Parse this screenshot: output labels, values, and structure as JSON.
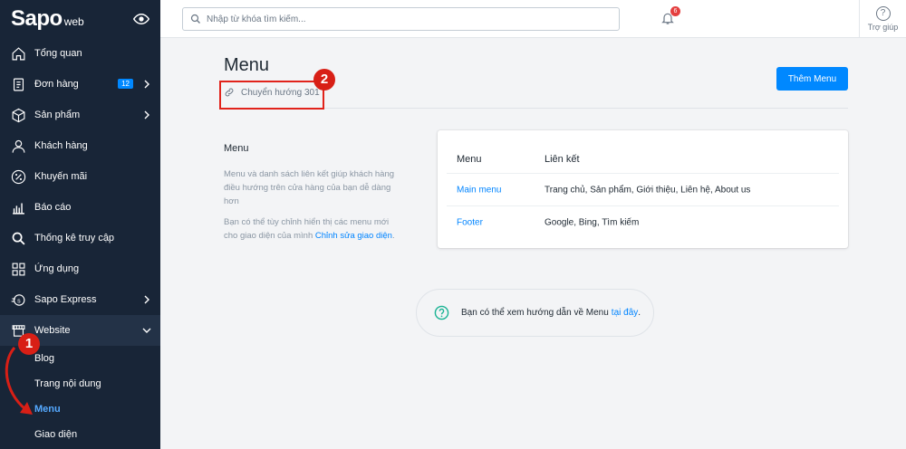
{
  "sidebar": {
    "logo_main": "Sapo",
    "logo_sub": "web",
    "items": [
      {
        "label": "Tổng quan"
      },
      {
        "label": "Đơn hàng",
        "badge": "12"
      },
      {
        "label": "Sản phẩm"
      },
      {
        "label": "Khách hàng"
      },
      {
        "label": "Khuyến mãi"
      },
      {
        "label": "Báo cáo"
      },
      {
        "label": "Thống kê truy cập"
      },
      {
        "label": "Ứng dụng"
      },
      {
        "label": "Sapo Express"
      },
      {
        "label": "Website"
      }
    ],
    "sub_items": [
      {
        "label": "Blog"
      },
      {
        "label": "Trang nội dung"
      },
      {
        "label": "Menu"
      },
      {
        "label": "Giao diện"
      }
    ]
  },
  "topbar": {
    "search_placeholder": "Nhập từ khóa tìm kiếm...",
    "notification_count": "6",
    "help_label": "Trợ giúp"
  },
  "main": {
    "title": "Menu",
    "redirect_label": "Chuyển hướng 301",
    "add_button": "Thêm Menu",
    "section_title": "Menu",
    "desc_1": "Menu và danh sách liên kết giúp khách hàng điều hướng trên cửa hàng của bạn dễ dàng hơn",
    "desc_2_prefix": "Bạn có thể tùy chỉnh hiển thị các menu mới cho giao diện của mình ",
    "desc_2_link": "Chỉnh sửa giao diện",
    "desc_2_suffix": ".",
    "table": {
      "headers": [
        "Menu",
        "Liên kết"
      ],
      "rows": [
        {
          "menu": "Main menu",
          "links": "Trang chủ, Sản phẩm, Giới thiệu, Liên hệ, About us"
        },
        {
          "menu": "Footer",
          "links": "Google, Bing, Tìm kiếm"
        }
      ]
    },
    "hint_prefix": "Bạn có thể xem hướng dẫn về Menu",
    "hint_link": "tại đây",
    "hint_suffix": "."
  },
  "annotations": {
    "marker_1": "1",
    "marker_2": "2",
    "color": "#d81f16"
  },
  "colors": {
    "sidebar_bg": "#182537",
    "accent": "#0088ff",
    "link": "#0084ff"
  }
}
